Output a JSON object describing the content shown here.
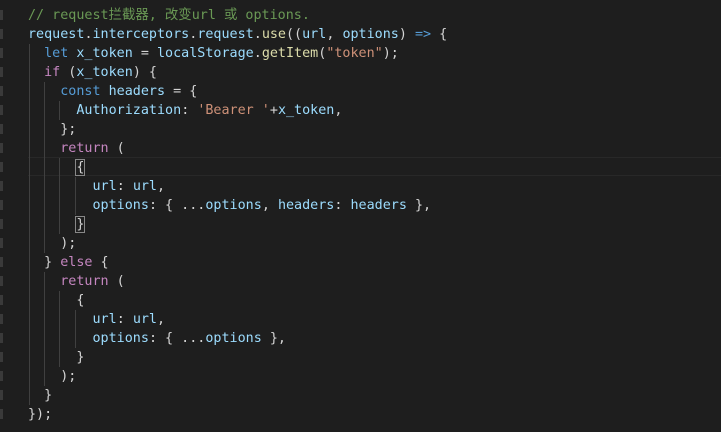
{
  "editor": {
    "language": "javascript",
    "colors": {
      "background": "#1e1e1e",
      "comment": "#6a9955",
      "keyword": "#569cd6",
      "control_flow": "#c586c0",
      "variable": "#9cdcfe",
      "function": "#dcdcaa",
      "string": "#ce9178",
      "plain": "#d4d4d4"
    },
    "lines": [
      {
        "tokens": [
          {
            "t": "// request拦截器, 改变url 或 options.",
            "c": "comment"
          }
        ]
      },
      {
        "tokens": [
          {
            "t": "request",
            "c": "variable"
          },
          {
            "t": ".",
            "c": "plain"
          },
          {
            "t": "interceptors",
            "c": "variable"
          },
          {
            "t": ".",
            "c": "plain"
          },
          {
            "t": "request",
            "c": "variable"
          },
          {
            "t": ".",
            "c": "plain"
          },
          {
            "t": "use",
            "c": "function"
          },
          {
            "t": "((",
            "c": "plain"
          },
          {
            "t": "url",
            "c": "variable"
          },
          {
            "t": ", ",
            "c": "plain"
          },
          {
            "t": "options",
            "c": "variable"
          },
          {
            "t": ") ",
            "c": "plain"
          },
          {
            "t": "=>",
            "c": "keyword"
          },
          {
            "t": " {",
            "c": "plain"
          }
        ]
      },
      {
        "tokens": [
          {
            "t": "  ",
            "c": "plain"
          },
          {
            "t": "let",
            "c": "keyword"
          },
          {
            "t": " ",
            "c": "plain"
          },
          {
            "t": "x_token",
            "c": "variable"
          },
          {
            "t": " = ",
            "c": "plain"
          },
          {
            "t": "localStorage",
            "c": "variable"
          },
          {
            "t": ".",
            "c": "plain"
          },
          {
            "t": "getItem",
            "c": "function"
          },
          {
            "t": "(",
            "c": "plain"
          },
          {
            "t": "\"token\"",
            "c": "string"
          },
          {
            "t": ");",
            "c": "plain"
          }
        ]
      },
      {
        "tokens": [
          {
            "t": "  ",
            "c": "plain"
          },
          {
            "t": "if",
            "c": "control_flow"
          },
          {
            "t": " (",
            "c": "plain"
          },
          {
            "t": "x_token",
            "c": "variable"
          },
          {
            "t": ") {",
            "c": "plain"
          }
        ]
      },
      {
        "tokens": [
          {
            "t": "    ",
            "c": "plain"
          },
          {
            "t": "const",
            "c": "keyword"
          },
          {
            "t": " ",
            "c": "plain"
          },
          {
            "t": "headers",
            "c": "variable"
          },
          {
            "t": " = {",
            "c": "plain"
          }
        ]
      },
      {
        "tokens": [
          {
            "t": "      ",
            "c": "plain"
          },
          {
            "t": "Authorization",
            "c": "variable"
          },
          {
            "t": ": ",
            "c": "plain"
          },
          {
            "t": "'Bearer '",
            "c": "string"
          },
          {
            "t": "+",
            "c": "plain"
          },
          {
            "t": "x_token",
            "c": "variable"
          },
          {
            "t": ",",
            "c": "plain"
          }
        ]
      },
      {
        "tokens": [
          {
            "t": "    };",
            "c": "plain"
          }
        ]
      },
      {
        "tokens": [
          {
            "t": "    ",
            "c": "plain"
          },
          {
            "t": "return",
            "c": "control_flow"
          },
          {
            "t": " (",
            "c": "plain"
          }
        ]
      },
      {
        "tokens": [
          {
            "t": "      ",
            "c": "plain"
          },
          {
            "t": "{",
            "c": "plain",
            "box": true
          }
        ]
      },
      {
        "tokens": [
          {
            "t": "        ",
            "c": "plain"
          },
          {
            "t": "url",
            "c": "variable"
          },
          {
            "t": ": ",
            "c": "plain"
          },
          {
            "t": "url",
            "c": "variable"
          },
          {
            "t": ",",
            "c": "plain"
          }
        ]
      },
      {
        "tokens": [
          {
            "t": "        ",
            "c": "plain"
          },
          {
            "t": "options",
            "c": "variable"
          },
          {
            "t": ": { ...",
            "c": "plain"
          },
          {
            "t": "options",
            "c": "variable"
          },
          {
            "t": ", ",
            "c": "plain"
          },
          {
            "t": "headers",
            "c": "variable"
          },
          {
            "t": ": ",
            "c": "plain"
          },
          {
            "t": "headers",
            "c": "variable"
          },
          {
            "t": " },",
            "c": "plain"
          }
        ]
      },
      {
        "tokens": [
          {
            "t": "      ",
            "c": "plain"
          },
          {
            "t": "}",
            "c": "plain",
            "box": true
          }
        ]
      },
      {
        "tokens": [
          {
            "t": "    );",
            "c": "plain"
          }
        ]
      },
      {
        "tokens": [
          {
            "t": "  } ",
            "c": "plain"
          },
          {
            "t": "else",
            "c": "control_flow"
          },
          {
            "t": " {",
            "c": "plain"
          }
        ]
      },
      {
        "tokens": [
          {
            "t": "    ",
            "c": "plain"
          },
          {
            "t": "return",
            "c": "control_flow"
          },
          {
            "t": " (",
            "c": "plain"
          }
        ]
      },
      {
        "tokens": [
          {
            "t": "      {",
            "c": "plain"
          }
        ]
      },
      {
        "tokens": [
          {
            "t": "        ",
            "c": "plain"
          },
          {
            "t": "url",
            "c": "variable"
          },
          {
            "t": ": ",
            "c": "plain"
          },
          {
            "t": "url",
            "c": "variable"
          },
          {
            "t": ",",
            "c": "plain"
          }
        ]
      },
      {
        "tokens": [
          {
            "t": "        ",
            "c": "plain"
          },
          {
            "t": "options",
            "c": "variable"
          },
          {
            "t": ": { ...",
            "c": "plain"
          },
          {
            "t": "options",
            "c": "variable"
          },
          {
            "t": " },",
            "c": "plain"
          }
        ]
      },
      {
        "tokens": [
          {
            "t": "      }",
            "c": "plain"
          }
        ]
      },
      {
        "tokens": [
          {
            "t": "    );",
            "c": "plain"
          }
        ]
      },
      {
        "tokens": [
          {
            "t": "  }",
            "c": "plain"
          }
        ]
      },
      {
        "tokens": [
          {
            "t": "});",
            "c": "plain"
          }
        ]
      }
    ]
  }
}
